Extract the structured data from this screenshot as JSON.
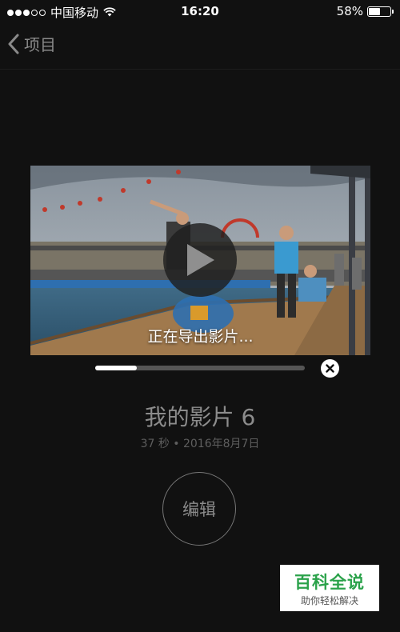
{
  "status_bar": {
    "carrier": "中国移动",
    "time": "16:20",
    "battery": "58%",
    "battery_level": 0.58,
    "signal_bars_filled": 3,
    "signal_bars_total": 5
  },
  "nav": {
    "back_label": "项目"
  },
  "player": {
    "export_text": "正在导出影片...",
    "export_progress": 0.2
  },
  "project": {
    "title": "我的影片 6",
    "meta": "37 秒 • 2016年8月7日"
  },
  "actions": {
    "edit_label": "编辑"
  },
  "watermark": {
    "title": "百科全说",
    "subtitle": "助你轻松解决"
  },
  "colors": {
    "background": "#111111",
    "text_muted": "#8c8c8c",
    "watermark_green": "#2aa24a"
  }
}
